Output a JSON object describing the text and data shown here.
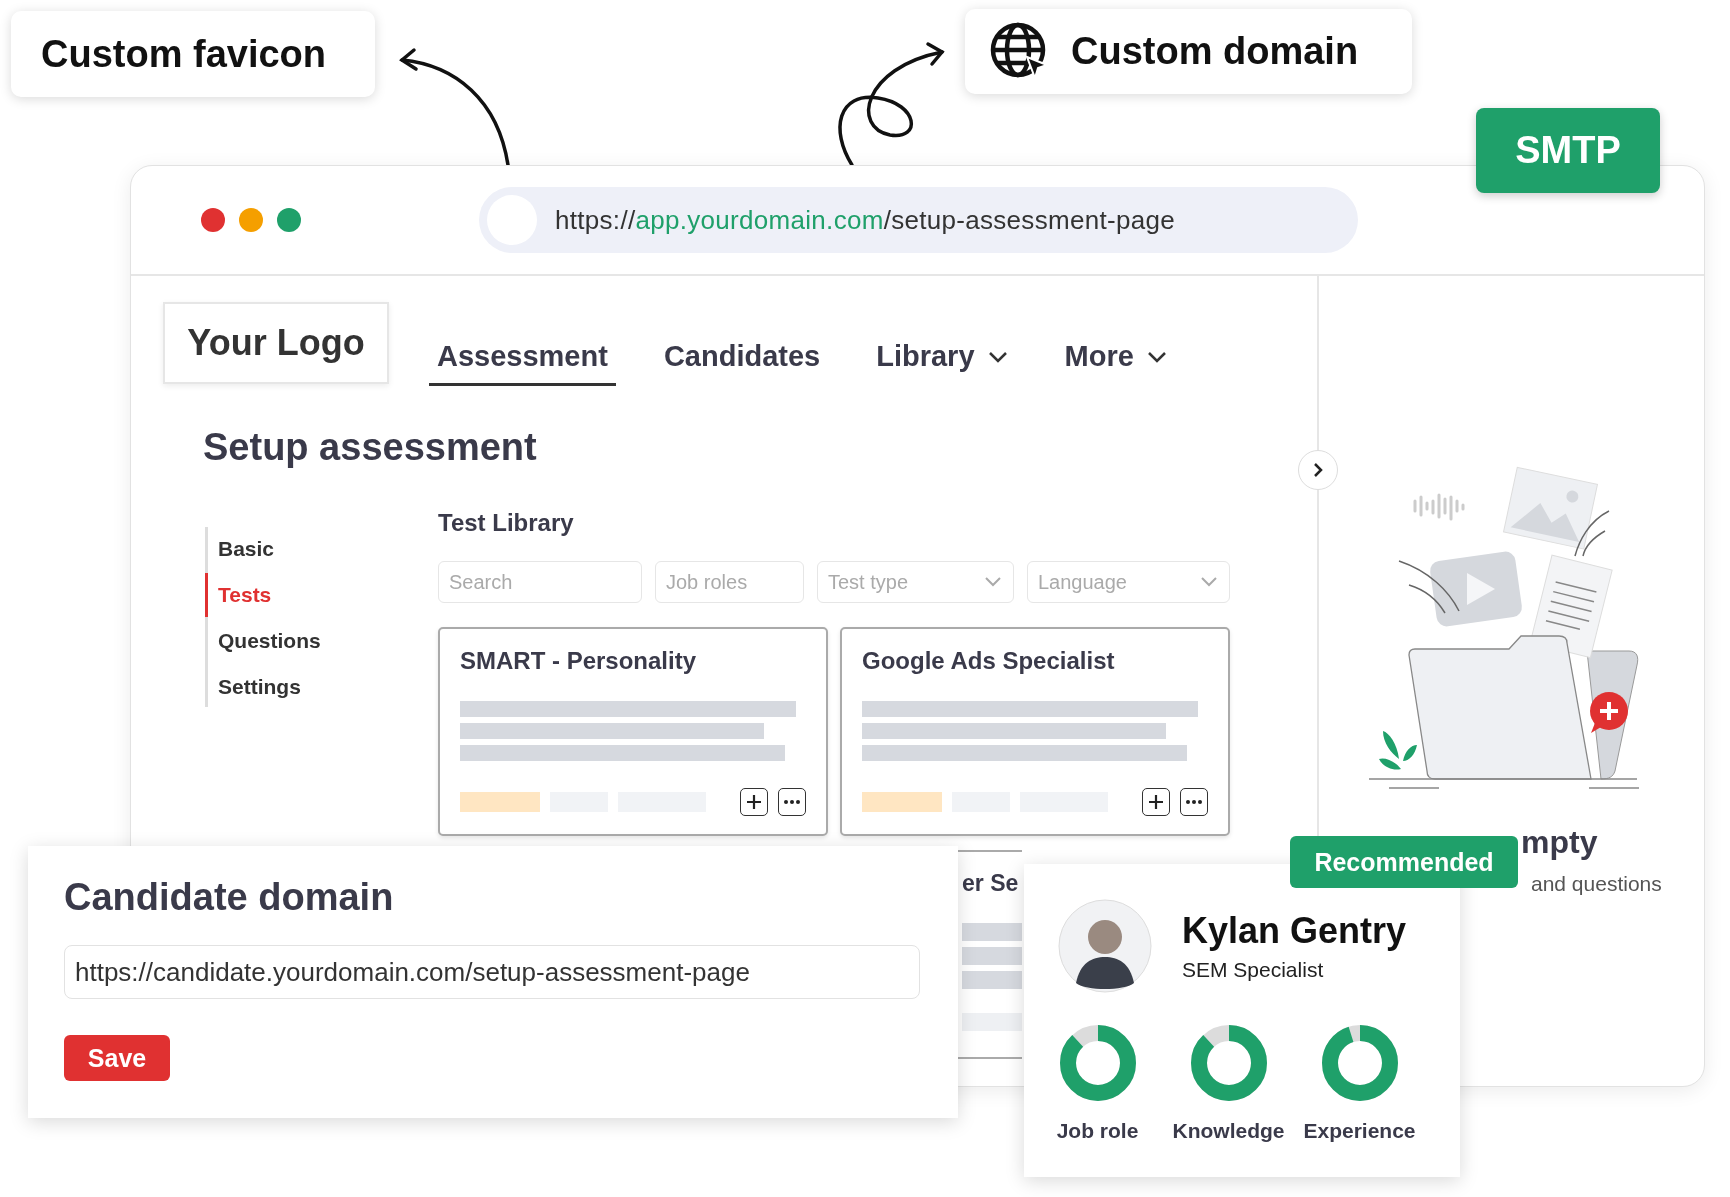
{
  "favicon_callout": {
    "label": "Custom favicon"
  },
  "domain_callout": {
    "label": "Custom domain"
  },
  "smtp_badge": {
    "label": "SMTP"
  },
  "address_bar": {
    "scheme": "https://",
    "domain": "app.yourdomain.com",
    "path": "/setup-assessment-page"
  },
  "logo": {
    "label": "Your Logo"
  },
  "nav_tabs": [
    {
      "label": "Assessment",
      "selected": true,
      "dropdown": false
    },
    {
      "label": "Candidates",
      "selected": false,
      "dropdown": false
    },
    {
      "label": "Library",
      "selected": false,
      "dropdown": true
    },
    {
      "label": "More",
      "selected": false,
      "dropdown": true
    }
  ],
  "page_title": "Setup assessment",
  "steps": [
    {
      "label": "Basic",
      "selected": false
    },
    {
      "label": "Tests",
      "selected": true
    },
    {
      "label": "Questions",
      "selected": false
    },
    {
      "label": "Settings",
      "selected": false
    }
  ],
  "section_title": "Test Library",
  "filters": [
    {
      "placeholder": "Search",
      "kind": "text"
    },
    {
      "placeholder": "Job roles",
      "kind": "text"
    },
    {
      "placeholder": "Test type",
      "kind": "select"
    },
    {
      "placeholder": "Language",
      "kind": "select"
    }
  ],
  "test_cards": [
    {
      "title": "SMART - Personality"
    },
    {
      "title": "Google Ads Specialist"
    }
  ],
  "partial_card": {
    "title": "er Se"
  },
  "empty_state": {
    "title": "mpty",
    "subtitle": "and questions"
  },
  "candidate_domain": {
    "title": "Candidate domain",
    "value": "https://candidate.yourdomain.com/setup-assessment-page",
    "button": "Save"
  },
  "candidate_card": {
    "badge": "Recommended",
    "name": "Kylan Gentry",
    "role": "SEM Specialist",
    "scores": [
      {
        "label": "Job role",
        "level": 0.88
      },
      {
        "label": "Knowledge",
        "level": 0.88
      },
      {
        "label": "Experience",
        "level": 0.95
      }
    ]
  }
}
